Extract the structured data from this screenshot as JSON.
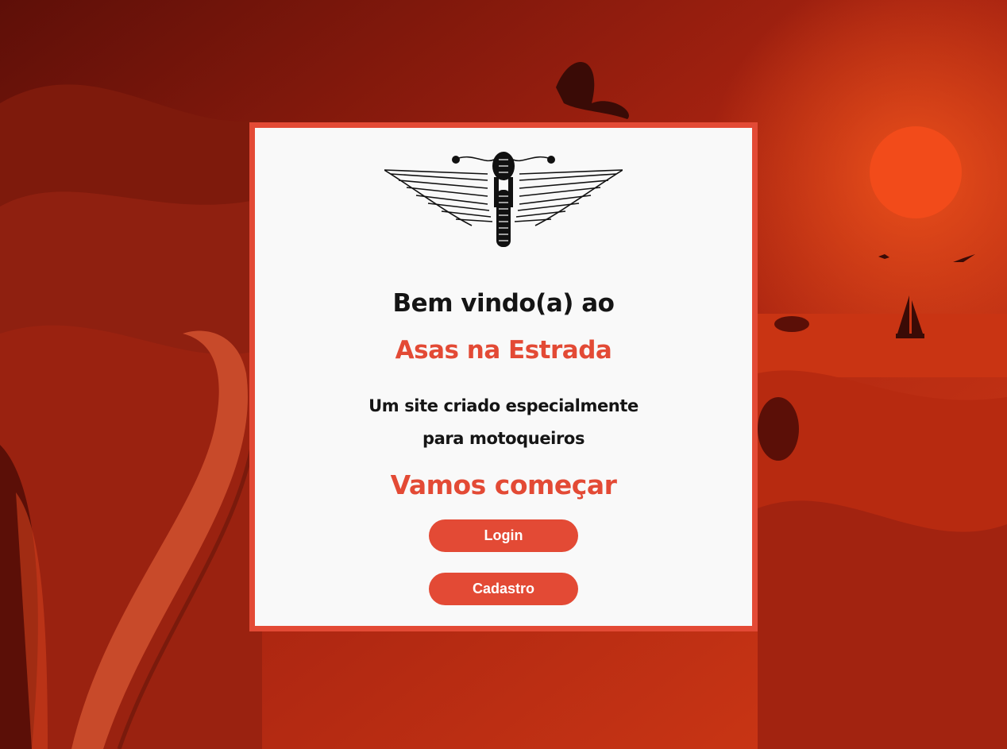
{
  "background": {
    "description_icon": "red-landscape-road-sea-sunset-illustration",
    "primary_color": "#b9250f"
  },
  "card": {
    "border_color": "#e34a35",
    "logo_icon": "winged-motorcycle-logo-icon",
    "welcome_text": "Bem vindo(a) ao",
    "brand_name": "Asas na Estrada",
    "description_line1": "Um site criado especialmente",
    "description_line2": "para motoqueiros",
    "cta_heading": "Vamos começar",
    "login_label": "Login",
    "signup_label": "Cadastro",
    "accent_color": "#e34a35"
  }
}
